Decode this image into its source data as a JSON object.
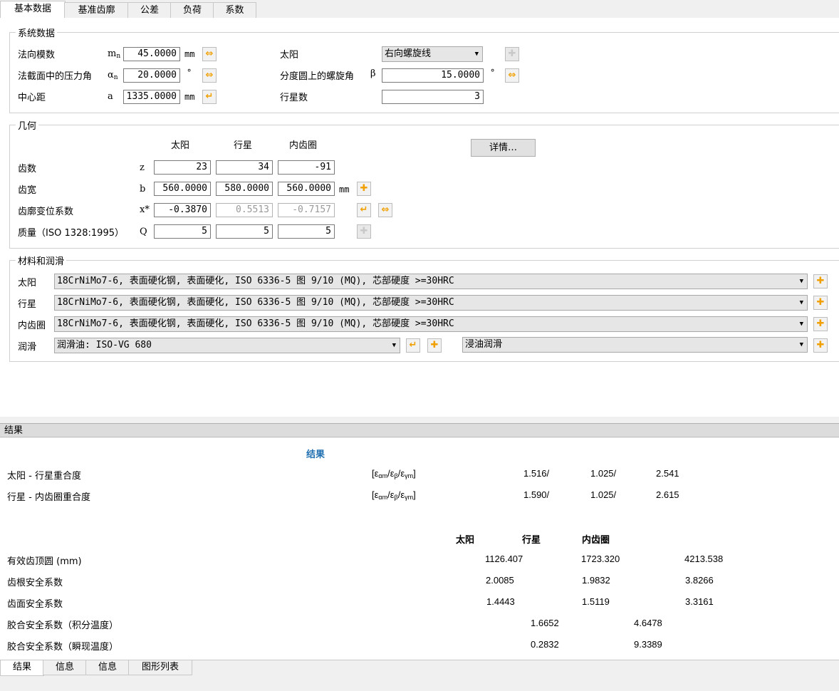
{
  "top_tabs": [
    "基本数据",
    "基准齿廓",
    "公差",
    "负荷",
    "系数"
  ],
  "system": {
    "title": "系统数据",
    "normal_module": {
      "label": "法向模数",
      "symbol": "m",
      "sub": "n",
      "value": "45.0000",
      "unit": "mm"
    },
    "pressure_angle": {
      "label": "法截面中的压力角",
      "symbol": "α",
      "sub": "n",
      "value": "20.0000",
      "unit": "°"
    },
    "center_distance": {
      "label": "中心距",
      "symbol": "a",
      "value": "1335.0000",
      "unit": "mm"
    },
    "sun": {
      "label": "太阳",
      "value": "右向螺旋线"
    },
    "helix_angle": {
      "label": "分度圆上的螺旋角",
      "symbol": "β",
      "value": "15.0000",
      "unit": "°"
    },
    "planets": {
      "label": "行星数",
      "value": "3"
    }
  },
  "geometry": {
    "title": "几何",
    "col_headers": [
      "太阳",
      "行星",
      "内齿圈"
    ],
    "details_button": "详情…",
    "rows": [
      {
        "label": "齿数",
        "symbol": "z",
        "values": [
          "23",
          "34",
          "-91"
        ],
        "unit": ""
      },
      {
        "label": "齿宽",
        "symbol": "b",
        "values": [
          "560.0000",
          "580.0000",
          "560.0000"
        ],
        "unit": "mm"
      },
      {
        "label": "齿廓变位系数",
        "symbol": "x*",
        "values": [
          "-0.3870",
          "0.5513",
          "-0.7157"
        ],
        "unit": ""
      },
      {
        "label": "质量（ISO 1328:1995）",
        "symbol": "Q",
        "values": [
          "5",
          "5",
          "5"
        ],
        "unit": ""
      }
    ]
  },
  "materials": {
    "title": "材料和润滑",
    "rows": [
      {
        "label": "太阳",
        "value": "18CrNiMo7-6, 表面硬化钢, 表面硬化, ISO 6336-5 图 9/10 (MQ), 芯部硬度 >=30HRC"
      },
      {
        "label": "行星",
        "value": "18CrNiMo7-6, 表面硬化钢, 表面硬化, ISO 6336-5 图 9/10 (MQ), 芯部硬度 >=30HRC"
      },
      {
        "label": "内齿圈",
        "value": "18CrNiMo7-6, 表面硬化钢, 表面硬化, ISO 6336-5 图 9/10 (MQ), 芯部硬度 >=30HRC"
      }
    ],
    "lube": {
      "label": "润滑",
      "oil": "润滑油: ISO-VG 680",
      "method": "浸油润滑"
    }
  },
  "results": {
    "panel_title": "结果",
    "heading": "结果",
    "contact": [
      {
        "label": "太阳 - 行星重合度",
        "v1": "1.516/",
        "v2": "1.025/",
        "v3": "2.541"
      },
      {
        "label": "行星 - 内齿圈重合度",
        "v1": "1.590/",
        "v2": "1.025/",
        "v3": "2.615"
      }
    ],
    "col_headers": [
      "太阳",
      "行星",
      "内齿圈"
    ],
    "rows3": [
      {
        "label": "有效齿顶圆 (mm)",
        "values": [
          "1126.407",
          "1723.320",
          "4213.538"
        ]
      },
      {
        "label": "齿根安全系数",
        "values": [
          "2.0085",
          "1.9832",
          "3.8266"
        ]
      },
      {
        "label": "齿面安全系数",
        "values": [
          "1.4443",
          "1.5119",
          "3.3161"
        ]
      }
    ],
    "rows2": [
      {
        "label": "胶合安全系数（积分温度）",
        "values": [
          "1.6652",
          "4.6478"
        ]
      },
      {
        "label": "胶合安全系数（瞬现温度）",
        "values": [
          "0.2832",
          "9.3389"
        ]
      }
    ]
  },
  "bottom_tabs": [
    "结果",
    "信息",
    "信息",
    "图形列表"
  ]
}
